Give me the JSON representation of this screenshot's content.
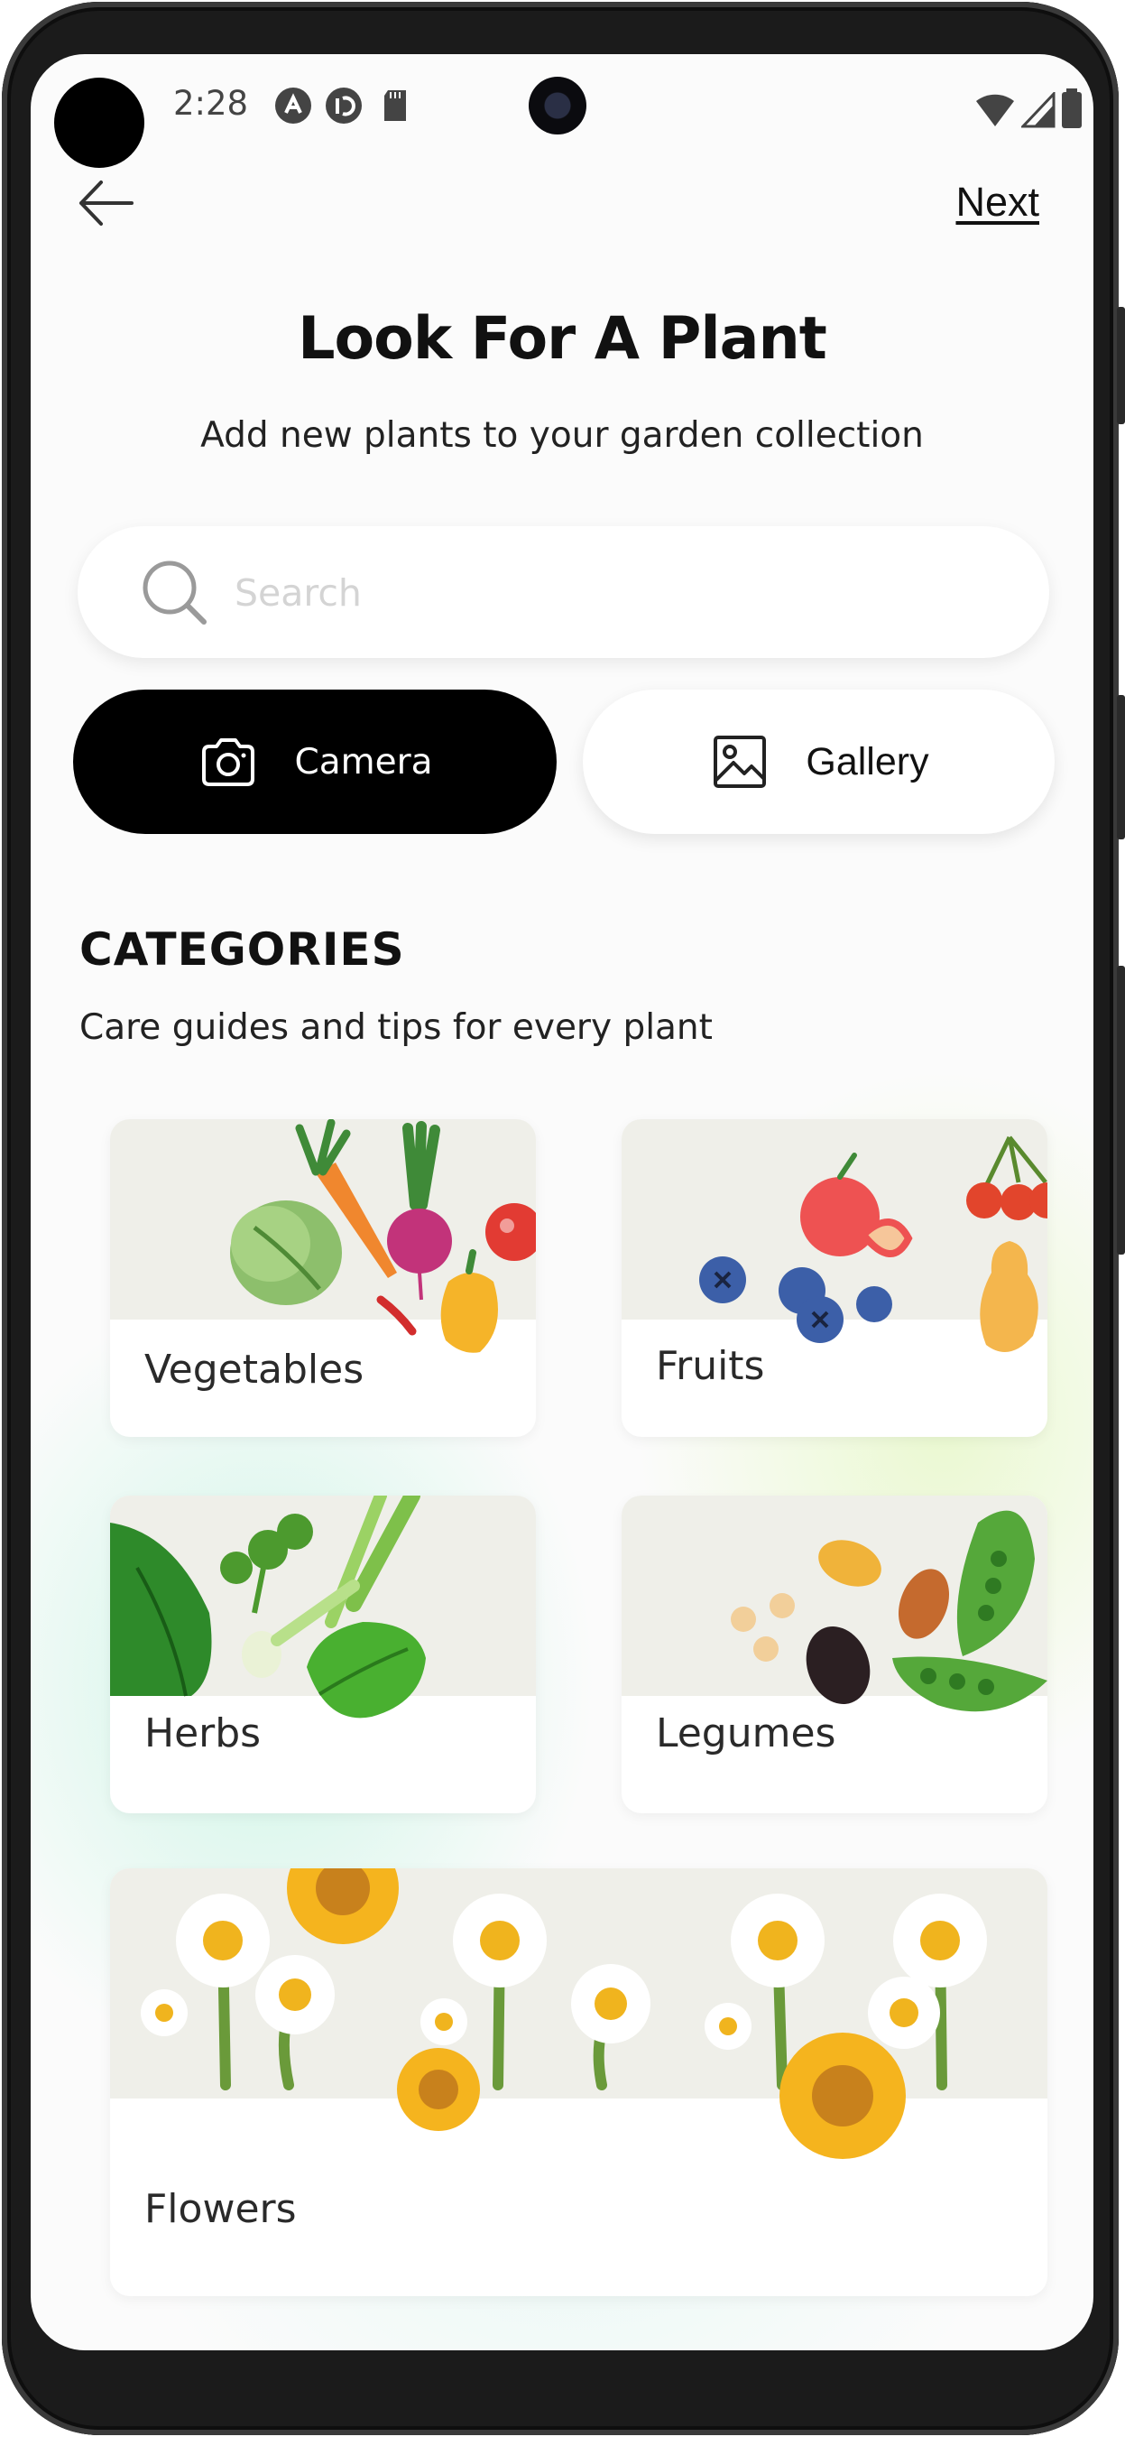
{
  "status_bar": {
    "time": "2:28",
    "icons": [
      "notification-a-icon",
      "notification-sync-icon",
      "sd-card-icon",
      "wifi-icon",
      "signal-icon",
      "battery-icon"
    ]
  },
  "header": {
    "back_icon": "arrow-left-icon",
    "next_label": "Next"
  },
  "main": {
    "title": "Look For A Plant",
    "subtitle": "Add new plants to your garden collection",
    "search": {
      "placeholder": "Search",
      "icon": "search-icon"
    },
    "camera_button": {
      "label": "Camera",
      "icon": "camera-icon"
    },
    "gallery_button": {
      "label": "Gallery",
      "icon": "image-icon"
    }
  },
  "categories": {
    "heading": "CATEGORIES",
    "subtitle": "Care guides and tips for every plant",
    "items": [
      {
        "label": "Vegetables"
      },
      {
        "label": "Fruits"
      },
      {
        "label": "Herbs"
      },
      {
        "label": "Legumes"
      },
      {
        "label": "Flowers"
      }
    ]
  },
  "colors": {
    "primary_button": "#000000",
    "card_image_bg": "#efefe9",
    "background_tint_green": "#c8f5e2",
    "background_tint_lime": "#e8f8c8"
  }
}
